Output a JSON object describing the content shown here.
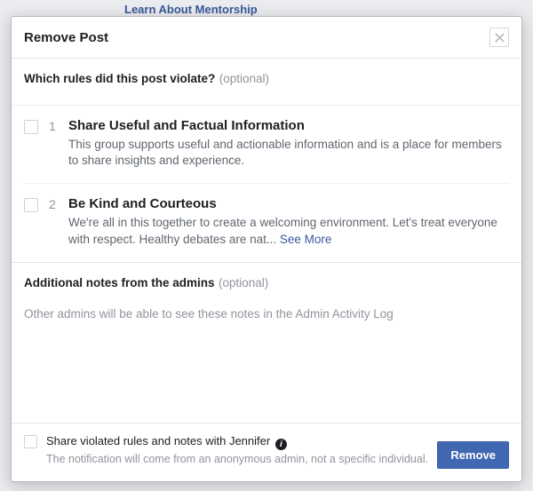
{
  "background_link": "Learn About Mentorship",
  "dialog": {
    "title": "Remove Post",
    "rules_heading": "Which rules did this post violate?",
    "optional_label": "(optional)",
    "rules": [
      {
        "num": "1",
        "title": "Share Useful and Factual Information",
        "desc": "This group supports useful and actionable information and is a place for members to share insights and experience."
      },
      {
        "num": "2",
        "title": "Be Kind and Courteous",
        "desc": "We're all in this together to create a welcoming environment. Let's treat everyone with respect. Healthy debates are nat... ",
        "see_more": "See More"
      }
    ],
    "notes_heading": "Additional notes from the admins",
    "notes_placeholder": "Other admins will be able to see these notes in the Admin Activity Log",
    "share_label": "Share violated rules and notes with Jennifer",
    "share_sub": "The notification will come from an anonymous admin, not a specific individual.",
    "remove_label": "Remove"
  }
}
